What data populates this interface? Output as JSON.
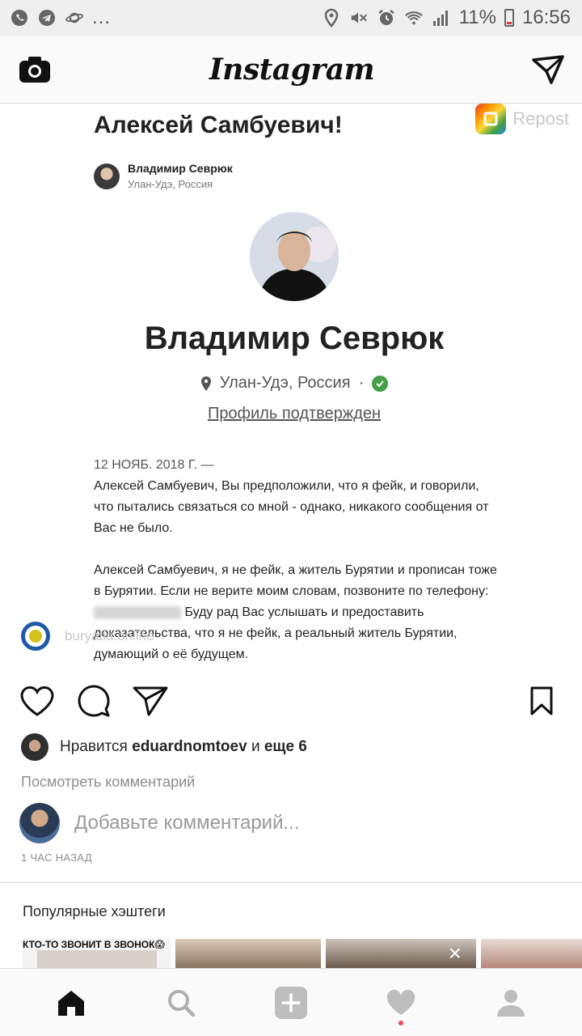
{
  "status_bar": {
    "left_icons": [
      "whatsapp-icon",
      "telegram-icon",
      "saturn-icon"
    ],
    "more": "...",
    "battery_percent": "11%",
    "time": "16:56"
  },
  "header": {
    "logo_text": "Instagram",
    "camera_icon": "camera-icon",
    "direct_icon": "paper-plane-icon"
  },
  "post": {
    "repost_label": "Repost",
    "headline": "Алексей Самбуевич!",
    "mini_author_name": "Владимир Севрюк",
    "mini_author_city": "Улан-Удэ, Россия",
    "profile_name": "Владимир Севрюк",
    "location": "Улан-Удэ, Россия",
    "dot": "·",
    "profile_confirmed": "Профиль подтвержден",
    "letter_date": "12 НОЯБ. 2018 Г. —",
    "letter_p1": "Алексей Самбуевич, Вы предположили, что я фейк, и говорили, что пытались связаться со мной - однако, никакого сообщения от Вас не было.",
    "letter_p2_a": "Алексей Самбуевич, я не фейк, а житель Бурятии и прописан тоже в Бурятии. Если не верите моим словам, позвоните по телефону:",
    "letter_p2_b": "Буду рад Вас услышать и предоставить доказательства, что я не фейк, а реальный житель Бурятии, думающий о её будущем.",
    "watermark": "buryatia.online"
  },
  "likes": {
    "prefix": "Нравится",
    "user": "eduardnomtoev",
    "conj": "и",
    "others": "еще 6"
  },
  "view_comments": "Посмотреть комментарий",
  "comment": {
    "placeholder": "Добавьте комментарий..."
  },
  "time_ago": "1 ЧАС НАЗАД",
  "popular": {
    "title": "Популярные хэштеги",
    "first_thumb_caption": "КТО-ТО ЗВОНИТ В ЗВОНОК😱",
    "close_glyph": "×"
  },
  "colors": {
    "accent_red": "#ed4956",
    "verified_green": "#43a047",
    "muted_text": "#8e8e8e"
  }
}
